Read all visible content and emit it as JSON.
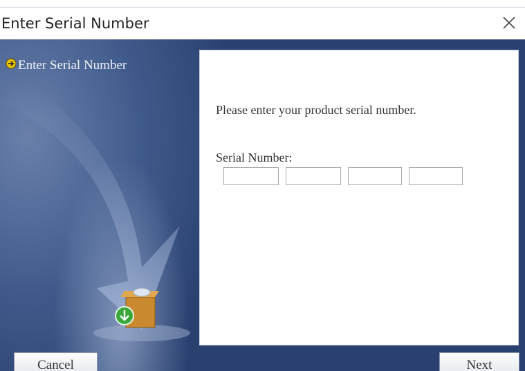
{
  "window": {
    "title": "Enter Serial Number",
    "close_icon": "close-icon"
  },
  "sidebar": {
    "step_label": "Enter Serial Number",
    "step_icon": "arrow-right-circle-icon"
  },
  "main": {
    "prompt": "Please enter your product serial number.",
    "serial_label": "Serial Number:",
    "serial_fields": [
      "",
      "",
      "",
      ""
    ]
  },
  "buttons": {
    "cancel": "Cancel",
    "next": "Next"
  },
  "colors": {
    "sidebar_bg": "#3f5a8a",
    "panel_bg": "#ffffff",
    "bullet": "#e8c400"
  }
}
